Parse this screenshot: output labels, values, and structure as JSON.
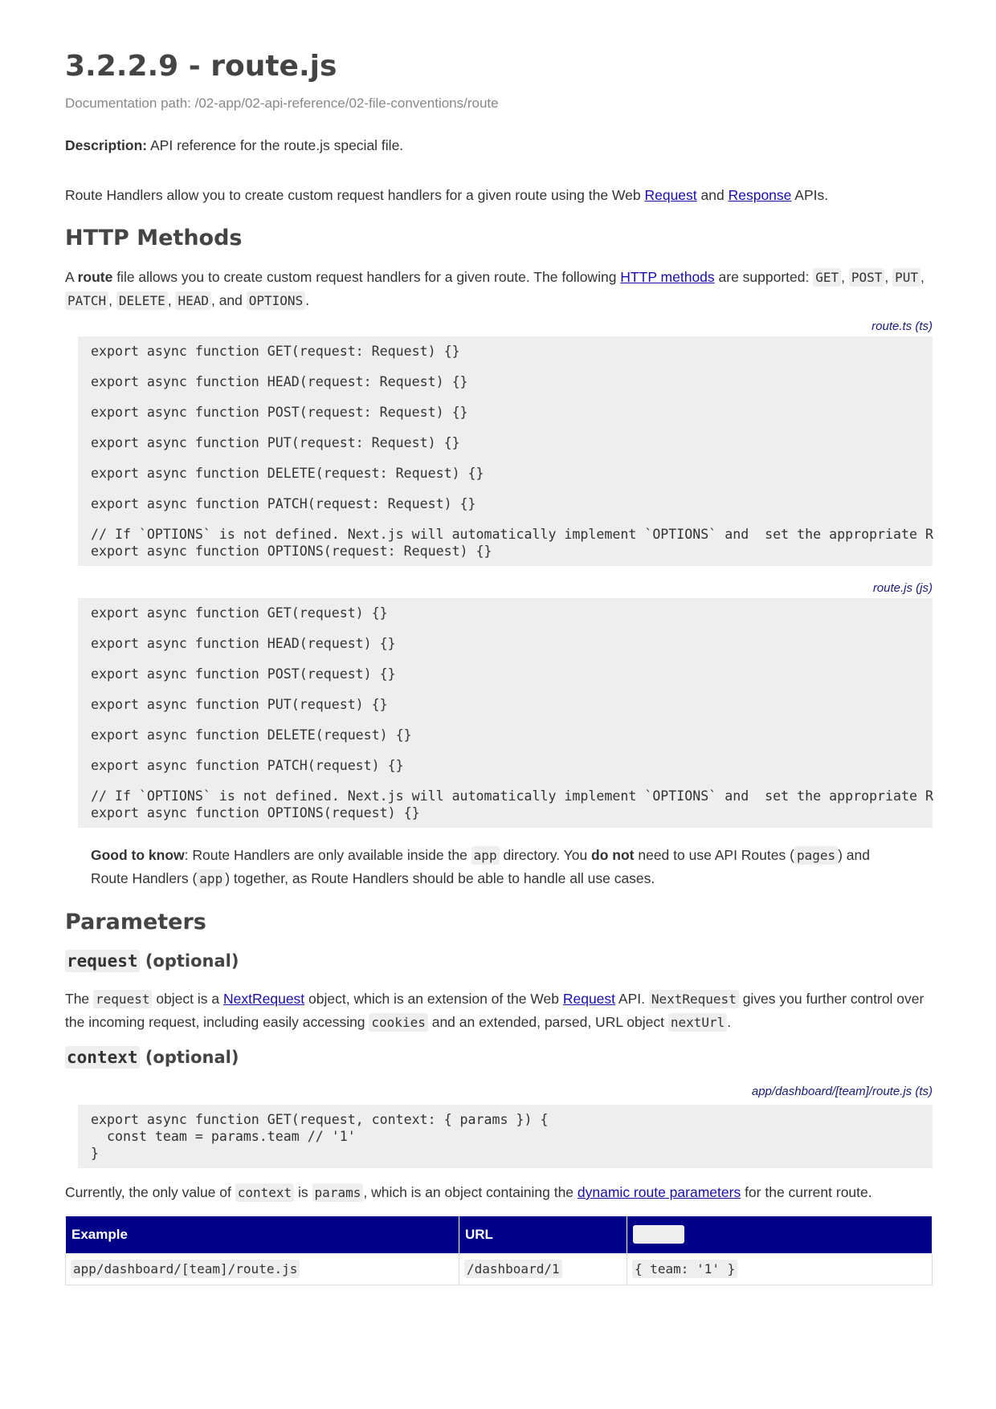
{
  "title": "3.2.2.9 - route.js",
  "doc_path": "Documentation path: /02-app/02-api-reference/02-file-conventions/route",
  "description": {
    "label": "Description:",
    "text": " API reference for the route.js special file."
  },
  "intro": {
    "t1": "Route Handlers allow you to create custom request handlers for a given route using the Web ",
    "link1": "Request",
    "t2": " and ",
    "link2": "Response",
    "t3": " APIs."
  },
  "http_methods": {
    "heading": "HTTP Methods",
    "p_a": "A ",
    "p_bold": "route",
    "p_b": " file allows you to create custom request handlers for a given route. The following ",
    "p_link": "HTTP methods",
    "p_c": " are supported: ",
    "methods": [
      "GET",
      "POST",
      "PUT",
      "PATCH",
      "DELETE",
      "HEAD",
      "OPTIONS"
    ],
    "sep_comma": ", ",
    "sep_and": ", and ",
    "end": "."
  },
  "code_ts": {
    "caption": "route.ts (ts)",
    "lines": [
      "export async function GET(request: Request) {}",
      "export async function HEAD(request: Request) {}",
      "export async function POST(request: Request) {}",
      "export async function PUT(request: Request) {}",
      "export async function DELETE(request: Request) {}",
      "export async function PATCH(request: Request) {}",
      "// If `OPTIONS` is not defined. Next.js will automatically implement `OPTIONS` and  set the appropriate R",
      "export async function OPTIONS(request: Request) {}"
    ]
  },
  "code_js": {
    "caption": "route.js (js)",
    "lines": [
      "export async function GET(request) {}",
      "export async function HEAD(request) {}",
      "export async function POST(request) {}",
      "export async function PUT(request) {}",
      "export async function DELETE(request) {}",
      "export async function PATCH(request) {}",
      "// If `OPTIONS` is not defined. Next.js will automatically implement `OPTIONS` and  set the appropriate R",
      "export async function OPTIONS(request) {}"
    ]
  },
  "note": {
    "bold1": "Good to know",
    "t1": ": Route Handlers are only available inside the ",
    "code1": "app",
    "t2": " directory. You ",
    "bold2": "do not",
    "t3": " need to use API Routes (",
    "code2": "pages",
    "t4": ") and Route Handlers (",
    "code3": "app",
    "t5": ") together, as Route Handlers should be able to handle all use cases."
  },
  "parameters": {
    "heading": "Parameters",
    "request": {
      "code": "request",
      "suffix": " (optional)",
      "t1": "The ",
      "code1": "request",
      "t2": " object is a ",
      "link1": "NextRequest",
      "t3": " object, which is an extension of the Web ",
      "link2": "Request",
      "t4": " API. ",
      "code2": "NextRequest",
      "t5": " gives you further control over the incoming request, including easily accessing ",
      "code3": "cookies",
      "t6": " and an extended, parsed, URL object ",
      "code4": "nextUrl",
      "t7": "."
    },
    "context": {
      "code": "context",
      "suffix": " (optional)",
      "caption": "app/dashboard/[team]/route.js (ts)",
      "lines": [
        "export async function GET(request, context: { params }) {",
        "  const team = params.team // '1'",
        "}"
      ],
      "t1": "Currently, the only value of ",
      "code1": "context",
      "t2": " is ",
      "code2": "params",
      "t3": ", which is an object containing the ",
      "link": "dynamic route parameters",
      "t4": " for the current route."
    }
  },
  "table": {
    "headers": [
      "Example",
      "URL",
      "params"
    ],
    "rows": [
      [
        "app/dashboard/[team]/route.js",
        "/dashboard/1",
        "{ team: '1' }"
      ]
    ]
  }
}
